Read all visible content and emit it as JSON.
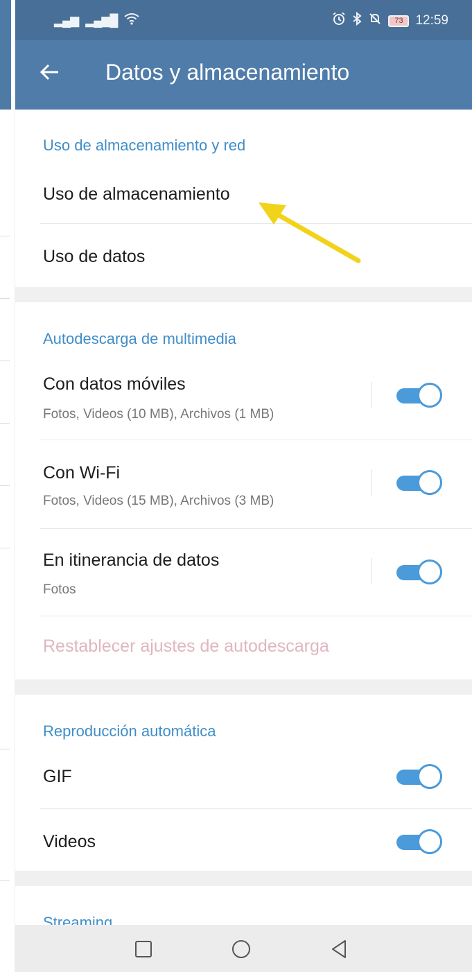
{
  "status_bar": {
    "signal_1": "▂▄▆",
    "signal_2": "▂▄▆█",
    "wifi": "☰",
    "alarm": "⏰",
    "bluetooth": "✱",
    "mute": "✕",
    "battery": "73",
    "time": "12:59"
  },
  "app_bar": {
    "back_glyph": "←",
    "title": "Datos y almacenamiento"
  },
  "sections": {
    "storage": {
      "header": "Uso de almacenamiento y red",
      "items": [
        {
          "label": "Uso de almacenamiento"
        },
        {
          "label": "Uso de datos"
        }
      ]
    },
    "autodownload": {
      "header": "Autodescarga de multimedia",
      "items": [
        {
          "label": "Con datos móviles",
          "detail": "Fotos, Videos (10 MB), Archivos (1 MB)",
          "enabled": true
        },
        {
          "label": "Con Wi-Fi",
          "detail": "Fotos, Videos (15 MB), Archivos (3 MB)",
          "enabled": true
        },
        {
          "label": "En itinerancia de datos",
          "detail": "Fotos",
          "enabled": true
        }
      ],
      "reset_label": "Restablecer ajustes de autodescarga"
    },
    "autoplay": {
      "header": "Reproducción automática",
      "items": [
        {
          "label": "GIF",
          "enabled": true
        },
        {
          "label": "Videos",
          "enabled": true
        }
      ]
    },
    "streaming": {
      "header": "Streaming"
    }
  },
  "annotation": {
    "arrow_color": "#f2d31b"
  },
  "colors": {
    "app_bar": "#4f7ca9",
    "status_bar": "#486f97",
    "accent": "#3f8ec8",
    "toggle_on": "#4b9ad9",
    "reset_text": "#e0b6bf"
  }
}
